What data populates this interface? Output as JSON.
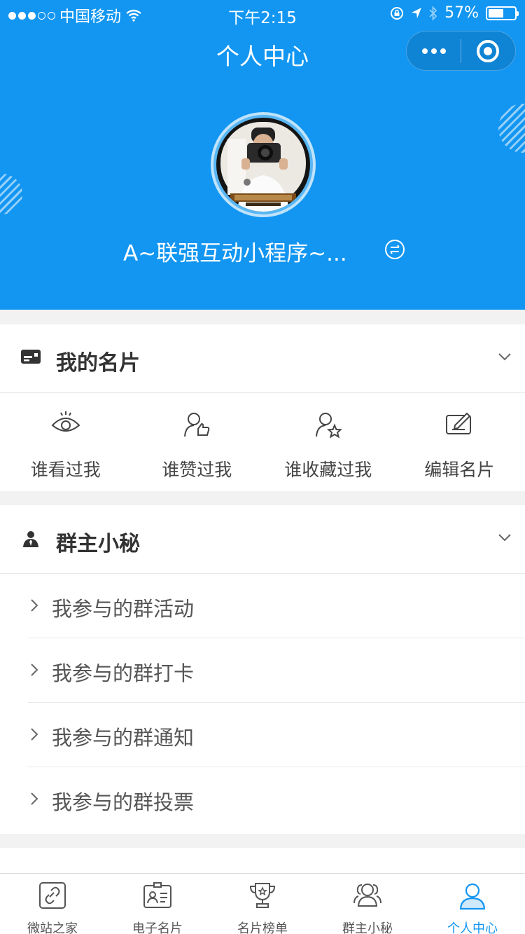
{
  "status_bar": {
    "carrier": "中国移动",
    "time": "下午2:15",
    "battery_text": "57%",
    "battery_level": 0.57
  },
  "nav": {
    "title": "个人中心"
  },
  "profile": {
    "name": "A~联强互动小程序~..."
  },
  "business_card": {
    "title": "我的名片",
    "items": [
      {
        "label": "谁看过我",
        "icon": "eye-icon"
      },
      {
        "label": "谁赞过我",
        "icon": "person-thumbs-up-icon"
      },
      {
        "label": "谁收藏过我",
        "icon": "person-star-icon"
      },
      {
        "label": "编辑名片",
        "icon": "edit-card-icon"
      }
    ]
  },
  "group_secretary": {
    "title": "群主小秘",
    "items": [
      {
        "label": "我参与的群活动"
      },
      {
        "label": "我参与的群打卡"
      },
      {
        "label": "我参与的群通知"
      },
      {
        "label": "我参与的群投票"
      }
    ]
  },
  "tabbar": {
    "active_color": "#1296f2",
    "tabs": [
      {
        "label": "微站之家",
        "icon": "link-icon"
      },
      {
        "label": "电子名片",
        "icon": "id-card-icon"
      },
      {
        "label": "名片榜单",
        "icon": "trophy-icon"
      },
      {
        "label": "群主小秘",
        "icon": "group-icon"
      },
      {
        "label": "个人中心",
        "icon": "user-icon",
        "active": true
      }
    ]
  },
  "colors": {
    "header_blue": "#1296f2"
  }
}
